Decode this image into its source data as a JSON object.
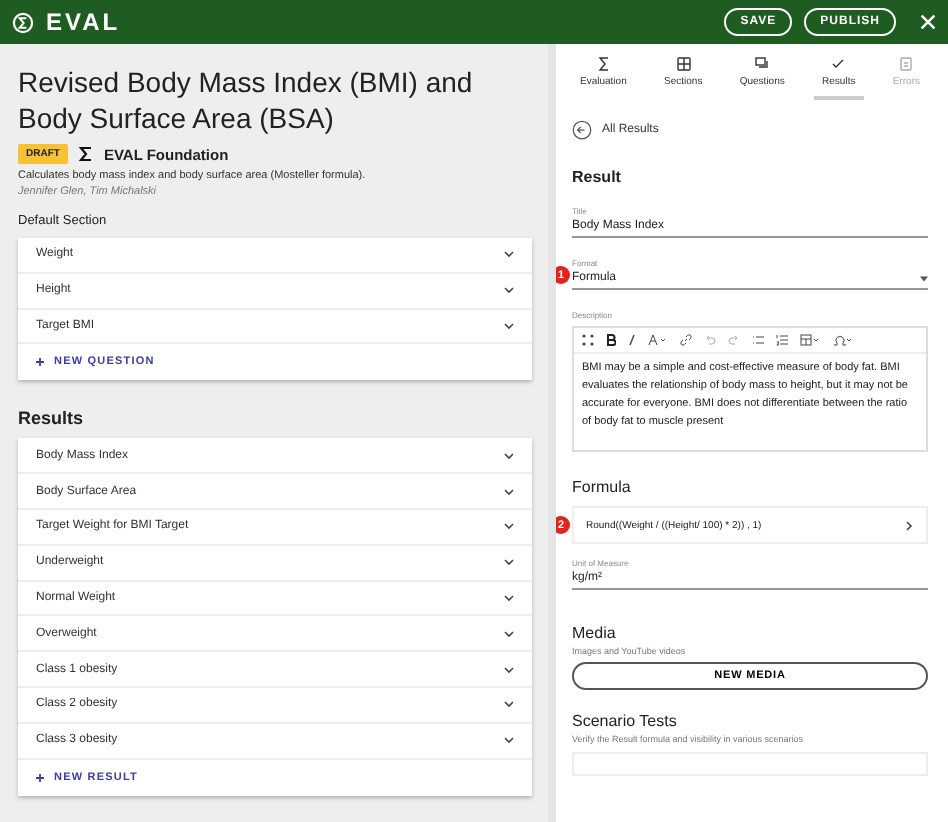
{
  "header": {
    "logo": "EVAL",
    "buttons": [
      "SAVE",
      "PUBLISH"
    ]
  },
  "evaluation": {
    "title": "Revised Body Mass Index (BMI) and Body Surface Area (BSA)",
    "status": "DRAFT",
    "publisher": "EVAL Foundation",
    "description": "Calculates body mass index and body surface area (Mosteller formula).",
    "authors": "Jennifer Glen, Tim Michalski"
  },
  "section": {
    "title": "Default Section",
    "questions": [
      "Weight",
      "Height",
      "Target BMI"
    ],
    "add_label": "NEW QUESTION"
  },
  "results": {
    "title": "Results",
    "items": [
      "Body Mass Index",
      "Body Surface Area",
      "Target Weight for BMI Target",
      "Underweight",
      "Normal Weight",
      "Overweight",
      "Class 1 obesity",
      "Class 2 obesity",
      "Class 3 obesity"
    ],
    "add_label": "NEW RESULT"
  },
  "tabs": [
    {
      "label": "Evaluation",
      "kind": "sigma",
      "selected": false,
      "disabled": false
    },
    {
      "label": "Sections",
      "kind": "grid",
      "selected": false,
      "disabled": false
    },
    {
      "label": "Questions",
      "kind": "chat",
      "selected": false,
      "disabled": false
    },
    {
      "label": "Results",
      "kind": "check",
      "selected": true,
      "disabled": false
    },
    {
      "label": "Errors",
      "kind": "doc",
      "selected": false,
      "disabled": true
    }
  ],
  "editor": {
    "back_label": "All Results",
    "heading": "Result",
    "title_field": {
      "label": "Title",
      "value": "Body Mass Index"
    },
    "format_field": {
      "label": "Format",
      "value": "Formula",
      "marker": "1"
    },
    "description": {
      "label": "Description",
      "text": "BMI may be a simple and cost-effective measure of body fat. BMI evaluates the relationship of body mass to height, but it may not be accurate for everyone. BMI does not differentiate between the ratio of body fat to muscle present"
    },
    "formula": {
      "heading": "Formula",
      "value": "Round((Weight / ((Height/ 100) * 2)) , 1)",
      "marker": "2"
    },
    "unit_field": {
      "label": "Unit of Measure",
      "value": "kg/m²"
    },
    "media": {
      "heading": "Media",
      "subtitle": "Images and YouTube videos",
      "button": "NEW MEDIA"
    },
    "scenarios": {
      "heading": "Scenario Tests",
      "subtitle": "Verify the Result formula and visibility in various scenarios"
    }
  }
}
